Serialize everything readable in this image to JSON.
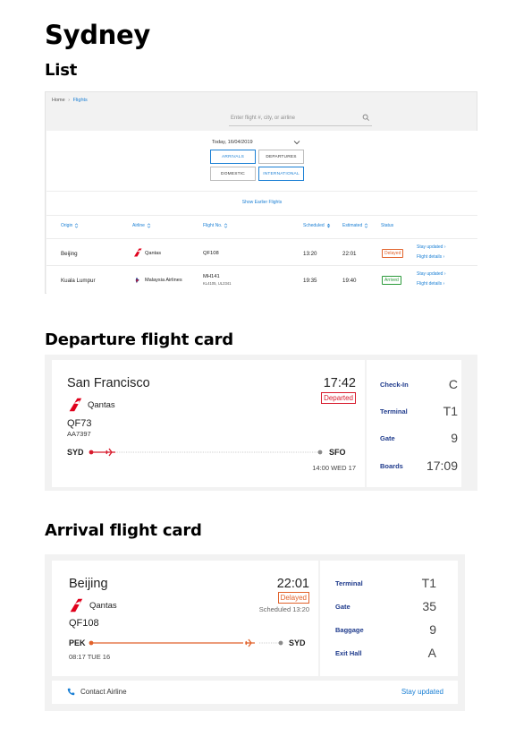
{
  "page": {
    "title": "Sydney",
    "section_list": "List",
    "section_departure": "Departure flight card",
    "section_arrival": "Arrival flight card"
  },
  "list": {
    "breadcrumb": {
      "home": "Home",
      "current": "Flights"
    },
    "search_placeholder": "Enter flight #, city, or airline",
    "date": "Today, 16/04/2019",
    "tabs": {
      "arrivals": "ARRIVALS",
      "departures": "DEPARTURES",
      "domestic": "DOMESTIC",
      "international": "INTERNATIONAL"
    },
    "show_earlier": "Show Earlier Flights",
    "headers": {
      "origin": "Origin",
      "airline": "Airline",
      "flight": "Flight No.",
      "scheduled": "Scheduled",
      "estimated": "Estimated",
      "status": "Status"
    },
    "rows": [
      {
        "origin": "Beijing",
        "airline": "Qantas",
        "flight": "QF108",
        "codeshare": "",
        "scheduled": "13:20",
        "estimated": "22:01",
        "status": "Delayed",
        "link1": "Stay updated",
        "link2": "Flight details"
      },
      {
        "origin": "Kuala Lumpur",
        "airline": "Malaysia Airlines",
        "flight": "MH141",
        "codeshare": "KL4105, UL2341",
        "scheduled": "19:35",
        "estimated": "19:40",
        "status": "Arrived",
        "link1": "Stay updated",
        "link2": "Flight details"
      }
    ]
  },
  "departure": {
    "city": "San Francisco",
    "time": "17:42",
    "status": "Departed",
    "airline": "Qantas",
    "flight": "QF73",
    "codeshare": "AA7397",
    "from": "SYD",
    "to": "SFO",
    "stamp": "14:00 WED 17",
    "info": [
      {
        "label": "Check-In",
        "value": "C"
      },
      {
        "label": "Terminal",
        "value": "T1"
      },
      {
        "label": "Gate",
        "value": "9"
      },
      {
        "label": "Boards",
        "value": "17:09"
      }
    ]
  },
  "arrival": {
    "city": "Beijing",
    "time": "22:01",
    "status": "Delayed",
    "scheduled": "Scheduled 13:20",
    "airline": "Qantas",
    "flight": "QF108",
    "from": "PEK",
    "to": "SYD",
    "stamp": "08:17 TUE 16",
    "info": [
      {
        "label": "Terminal",
        "value": "T1"
      },
      {
        "label": "Gate",
        "value": "35"
      },
      {
        "label": "Baggage",
        "value": "9"
      },
      {
        "label": "Exit Hall",
        "value": "A"
      }
    ],
    "contact": "Contact Airline",
    "stay_updated": "Stay updated"
  },
  "colors": {
    "link_blue": "#1a7fd4",
    "label_navy": "#1f3b8c",
    "departed_red": "#d71a2c",
    "delayed_orange": "#e1622b",
    "arrived_green": "#2b9a3a"
  },
  "icons": [
    "chevron-right-icon",
    "search-icon",
    "chevron-down-icon",
    "sort-icon",
    "qantas-logo",
    "malaysia-airlines-logo",
    "plane-icon",
    "phone-icon"
  ]
}
